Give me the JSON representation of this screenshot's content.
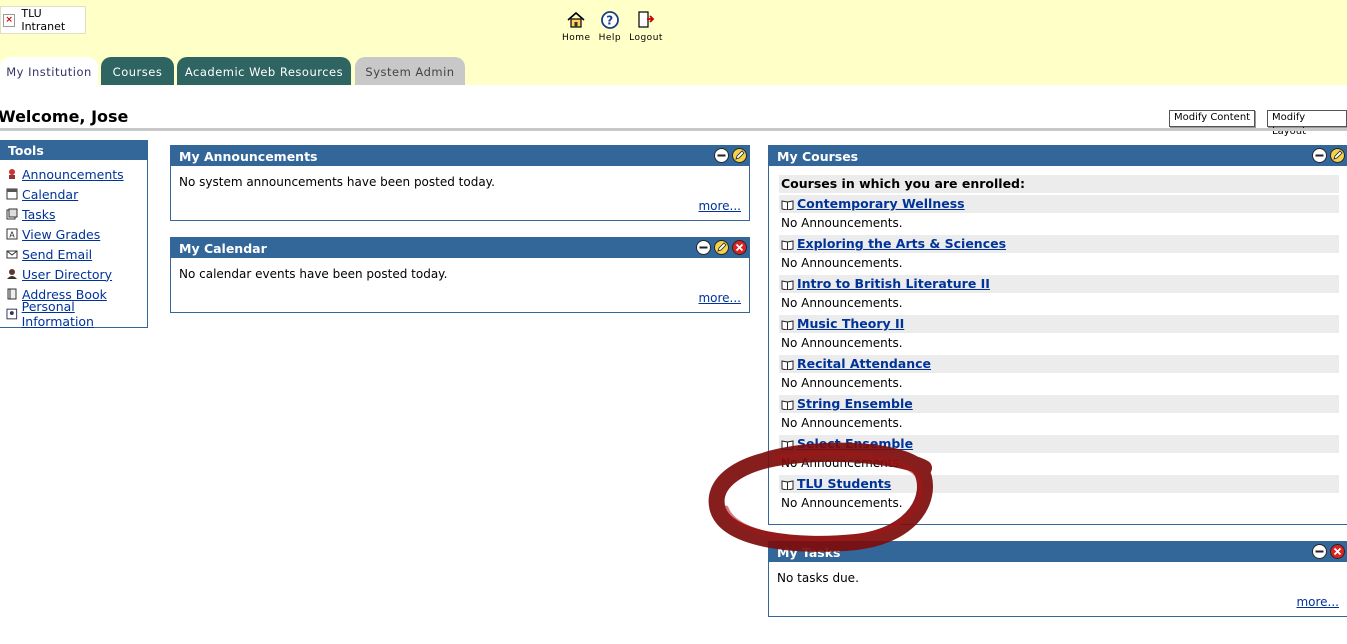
{
  "header": {
    "logo_text": "TLU Intranet",
    "nav": [
      {
        "label": "Home",
        "icon": "home-icon"
      },
      {
        "label": "Help",
        "icon": "help-icon"
      },
      {
        "label": "Logout",
        "icon": "logout-icon"
      }
    ]
  },
  "tabs": [
    {
      "label": "My Institution",
      "state": "active"
    },
    {
      "label": "Courses",
      "state": "normal"
    },
    {
      "label": "Academic Web Resources",
      "state": "normal"
    },
    {
      "label": "System Admin",
      "state": "disabled"
    }
  ],
  "page": {
    "welcome": "Welcome, Jose",
    "modify_content": "Modify Content",
    "modify_layout": "Modify Layout"
  },
  "tools": {
    "title": "Tools",
    "items": [
      {
        "label": "Announcements",
        "icon": "announcements-icon"
      },
      {
        "label": "Calendar",
        "icon": "calendar-icon"
      },
      {
        "label": "Tasks",
        "icon": "tasks-icon"
      },
      {
        "label": "View Grades",
        "icon": "grades-icon"
      },
      {
        "label": "Send Email",
        "icon": "email-icon"
      },
      {
        "label": "User Directory",
        "icon": "user-directory-icon"
      },
      {
        "label": "Address Book",
        "icon": "address-book-icon"
      },
      {
        "label": "Personal Information",
        "icon": "personal-info-icon"
      }
    ]
  },
  "announcements": {
    "title": "My Announcements",
    "text": "No system announcements have been posted today.",
    "more": "more..."
  },
  "calendar": {
    "title": "My Calendar",
    "text": "No calendar events have been posted today.",
    "more": "more..."
  },
  "courses": {
    "title": "My Courses",
    "heading": "Courses in which you are enrolled:",
    "no_announcements": "No Announcements.",
    "items": [
      "Contemporary Wellness",
      "Exploring the Arts & Sciences",
      "Intro to British Literature II",
      "Music Theory II",
      "Recital Attendance",
      "String Ensemble",
      "Select Ensemble",
      "TLU Students"
    ]
  },
  "tasks": {
    "title": "My Tasks",
    "text": "No tasks due.",
    "more": "more..."
  },
  "colors": {
    "header_bg": "#ffffc8",
    "module_bar": "#336699",
    "tab_dark": "#2e6461",
    "link": "#00339a",
    "annotation": "#8b0000"
  }
}
